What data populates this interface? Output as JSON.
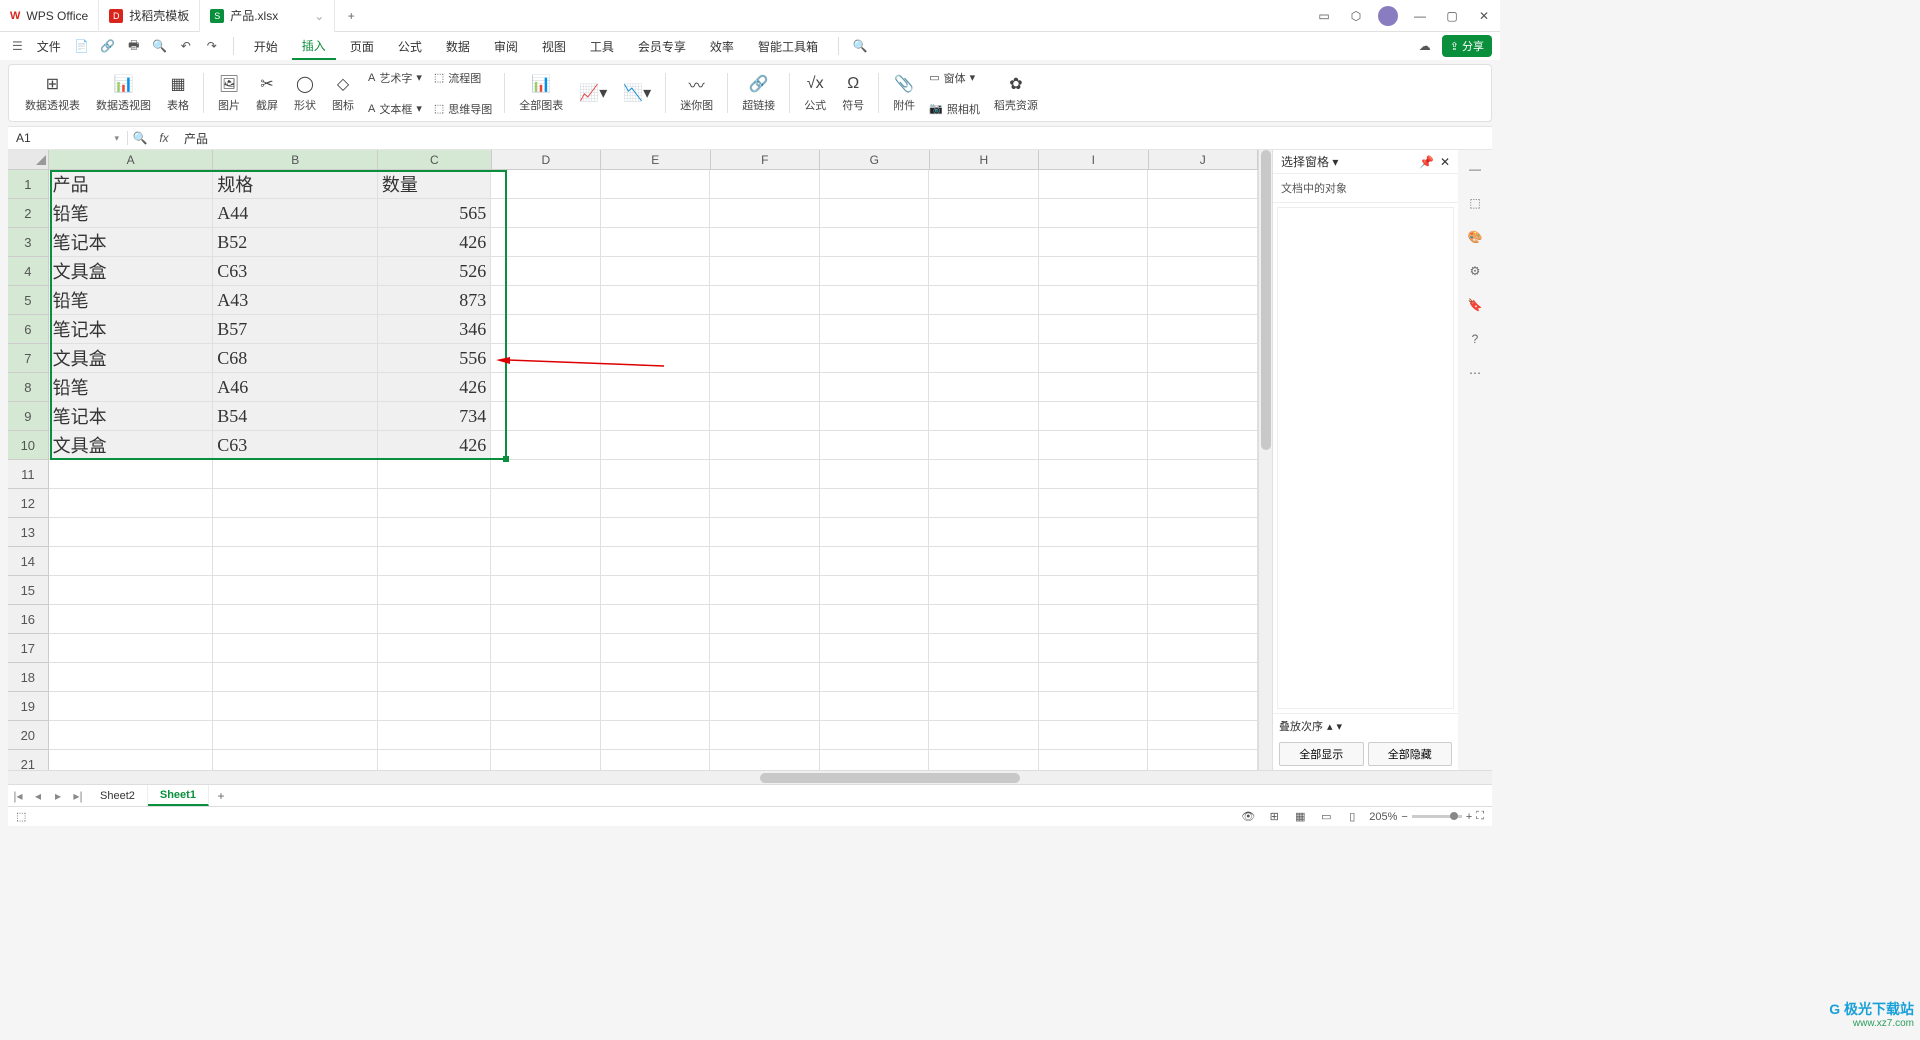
{
  "titlebar": {
    "app": "WPS Office",
    "tab1": "找稻壳模板",
    "tab2": "产品.xlsx"
  },
  "menubar": {
    "file": "文件",
    "tabs": [
      "开始",
      "插入",
      "页面",
      "公式",
      "数据",
      "审阅",
      "视图",
      "工具",
      "会员专享",
      "效率",
      "智能工具箱"
    ],
    "share": "分享"
  },
  "ribbon": {
    "g1": "数据透视表",
    "g2": "数据透视图",
    "g3": "表格",
    "g4": "图片",
    "g5": "截屏",
    "g6": "形状",
    "g7": "图标",
    "s1a": "艺术字",
    "s1b": "文本框",
    "s2a": "流程图",
    "s2b": "思维导图",
    "g8": "全部图表",
    "g9": "迷你图",
    "g10": "超链接",
    "g11": "公式",
    "g12": "符号",
    "g13": "附件",
    "s3a": "窗体",
    "s3b": "照相机",
    "g14": "稻壳资源"
  },
  "namebox": "A1",
  "formula": "产品",
  "columns": [
    "A",
    "B",
    "C",
    "D",
    "E",
    "F",
    "G",
    "H",
    "I",
    "J"
  ],
  "table": {
    "headers": [
      "产品",
      "规格",
      "数量"
    ],
    "rows": [
      [
        "铅笔",
        "A44",
        "565"
      ],
      [
        "笔记本",
        "B52",
        "426"
      ],
      [
        "文具盒",
        "C63",
        "526"
      ],
      [
        "铅笔",
        "A43",
        "873"
      ],
      [
        "笔记本",
        "B57",
        "346"
      ],
      [
        "文具盒",
        "C68",
        "556"
      ],
      [
        "铅笔",
        "A46",
        "426"
      ],
      [
        "笔记本",
        "B54",
        "734"
      ],
      [
        "文具盒",
        "C63",
        "426"
      ]
    ]
  },
  "rpanel": {
    "title": "选择窗格",
    "section": "文档中的对象",
    "order": "叠放次序",
    "showall": "全部显示",
    "hideall": "全部隐藏"
  },
  "sheets": {
    "s1": "Sheet2",
    "s2": "Sheet1"
  },
  "status": {
    "zoom": "205%"
  },
  "watermark": {
    "t1": "极光下载站",
    "t2": "www.xz7.com"
  }
}
